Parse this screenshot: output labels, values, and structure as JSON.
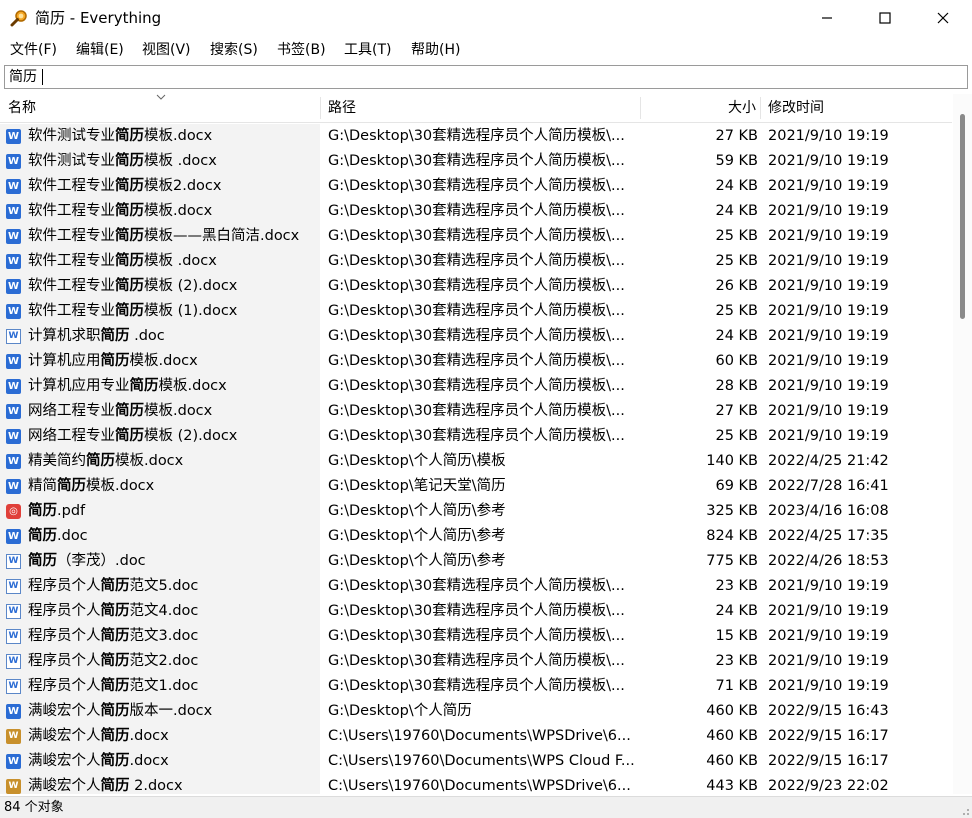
{
  "window": {
    "title": "简历 - Everything"
  },
  "menu": [
    "文件(F)",
    "编辑(E)",
    "视图(V)",
    "搜索(S)",
    "书签(B)",
    "工具(T)",
    "帮助(H)"
  ],
  "search": {
    "value": "简历"
  },
  "columns": {
    "name": "名称",
    "path": "路径",
    "size": "大小",
    "modified": "修改时间"
  },
  "icons": {
    "app": "magnifier-icon",
    "minimize": "minimize-icon",
    "maximize": "maximize-icon",
    "close": "close-icon"
  },
  "files": [
    {
      "pre": "软件测试专业",
      "hl": "简历",
      "post": "模板.docx",
      "type": "docx",
      "path": "G:\\Desktop\\30套精选程序员个人简历模板\\...",
      "size": "27 KB",
      "date": "2021/9/10 19:19"
    },
    {
      "pre": "软件测试专业",
      "hl": "简历",
      "post": "模板 .docx",
      "type": "docx",
      "path": "G:\\Desktop\\30套精选程序员个人简历模板\\...",
      "size": "59 KB",
      "date": "2021/9/10 19:19"
    },
    {
      "pre": "软件工程专业",
      "hl": "简历",
      "post": "模板2.docx",
      "type": "docx",
      "path": "G:\\Desktop\\30套精选程序员个人简历模板\\...",
      "size": "24 KB",
      "date": "2021/9/10 19:19"
    },
    {
      "pre": "软件工程专业",
      "hl": "简历",
      "post": "模板.docx",
      "type": "docx",
      "path": "G:\\Desktop\\30套精选程序员个人简历模板\\...",
      "size": "24 KB",
      "date": "2021/9/10 19:19"
    },
    {
      "pre": "软件工程专业",
      "hl": "简历",
      "post": "模板——黑白简洁.docx",
      "type": "docx",
      "path": "G:\\Desktop\\30套精选程序员个人简历模板\\...",
      "size": "25 KB",
      "date": "2021/9/10 19:19"
    },
    {
      "pre": "软件工程专业",
      "hl": "简历",
      "post": "模板 .docx",
      "type": "docx",
      "path": "G:\\Desktop\\30套精选程序员个人简历模板\\...",
      "size": "25 KB",
      "date": "2021/9/10 19:19"
    },
    {
      "pre": "软件工程专业",
      "hl": "简历",
      "post": "模板 (2).docx",
      "type": "docx",
      "path": "G:\\Desktop\\30套精选程序员个人简历模板\\...",
      "size": "26 KB",
      "date": "2021/9/10 19:19"
    },
    {
      "pre": "软件工程专业",
      "hl": "简历",
      "post": "模板 (1).docx",
      "type": "docx",
      "path": "G:\\Desktop\\30套精选程序员个人简历模板\\...",
      "size": "25 KB",
      "date": "2021/9/10 19:19"
    },
    {
      "pre": "计算机求职",
      "hl": "简历",
      "post": " .doc",
      "type": "doc",
      "path": "G:\\Desktop\\30套精选程序员个人简历模板\\...",
      "size": "24 KB",
      "date": "2021/9/10 19:19"
    },
    {
      "pre": "计算机应用",
      "hl": "简历",
      "post": "模板.docx",
      "type": "docx",
      "path": "G:\\Desktop\\30套精选程序员个人简历模板\\...",
      "size": "60 KB",
      "date": "2021/9/10 19:19"
    },
    {
      "pre": "计算机应用专业",
      "hl": "简历",
      "post": "模板.docx",
      "type": "docx",
      "path": "G:\\Desktop\\30套精选程序员个人简历模板\\...",
      "size": "28 KB",
      "date": "2021/9/10 19:19"
    },
    {
      "pre": "网络工程专业",
      "hl": "简历",
      "post": "模板.docx",
      "type": "docx",
      "path": "G:\\Desktop\\30套精选程序员个人简历模板\\...",
      "size": "27 KB",
      "date": "2021/9/10 19:19"
    },
    {
      "pre": "网络工程专业",
      "hl": "简历",
      "post": "模板 (2).docx",
      "type": "docx",
      "path": "G:\\Desktop\\30套精选程序员个人简历模板\\...",
      "size": "25 KB",
      "date": "2021/9/10 19:19"
    },
    {
      "pre": "精美简约",
      "hl": "简历",
      "post": "模板.docx",
      "type": "docx",
      "path": "G:\\Desktop\\个人简历\\模板",
      "size": "140 KB",
      "date": "2022/4/25 21:42"
    },
    {
      "pre": "精简",
      "hl": "简历",
      "post": "模板.docx",
      "type": "docx",
      "path": "G:\\Desktop\\笔记天堂\\简历",
      "size": "69 KB",
      "date": "2022/7/28 16:41"
    },
    {
      "pre": "",
      "hl": "简历",
      "post": ".pdf",
      "type": "pdf",
      "path": "G:\\Desktop\\个人简历\\参考",
      "size": "325 KB",
      "date": "2023/4/16 16:08"
    },
    {
      "pre": "",
      "hl": "简历",
      "post": ".doc",
      "type": "docx",
      "path": "G:\\Desktop\\个人简历\\参考",
      "size": "824 KB",
      "date": "2022/4/25 17:35"
    },
    {
      "pre": "",
      "hl": "简历",
      "post": "（李茂）.doc",
      "type": "doc",
      "path": "G:\\Desktop\\个人简历\\参考",
      "size": "775 KB",
      "date": "2022/4/26 18:53"
    },
    {
      "pre": "程序员个人",
      "hl": "简历",
      "post": "范文5.doc",
      "type": "doc",
      "path": "G:\\Desktop\\30套精选程序员个人简历模板\\...",
      "size": "23 KB",
      "date": "2021/9/10 19:19"
    },
    {
      "pre": "程序员个人",
      "hl": "简历",
      "post": "范文4.doc",
      "type": "doc",
      "path": "G:\\Desktop\\30套精选程序员个人简历模板\\...",
      "size": "24 KB",
      "date": "2021/9/10 19:19"
    },
    {
      "pre": "程序员个人",
      "hl": "简历",
      "post": "范文3.doc",
      "type": "doc",
      "path": "G:\\Desktop\\30套精选程序员个人简历模板\\...",
      "size": "15 KB",
      "date": "2021/9/10 19:19"
    },
    {
      "pre": "程序员个人",
      "hl": "简历",
      "post": "范文2.doc",
      "type": "doc",
      "path": "G:\\Desktop\\30套精选程序员个人简历模板\\...",
      "size": "23 KB",
      "date": "2021/9/10 19:19"
    },
    {
      "pre": "程序员个人",
      "hl": "简历",
      "post": "范文1.doc",
      "type": "doc",
      "path": "G:\\Desktop\\30套精选程序员个人简历模板\\...",
      "size": "71 KB",
      "date": "2021/9/10 19:19"
    },
    {
      "pre": "满峻宏个人",
      "hl": "简历",
      "post": "版本一.docx",
      "type": "docx",
      "path": "G:\\Desktop\\个人简历",
      "size": "460 KB",
      "date": "2022/9/15 16:43"
    },
    {
      "pre": "满峻宏个人",
      "hl": "简历",
      "post": ".docx",
      "type": "wps",
      "path": "C:\\Users\\19760\\Documents\\WPSDrive\\6...",
      "size": "460 KB",
      "date": "2022/9/15 16:17"
    },
    {
      "pre": "满峻宏个人",
      "hl": "简历",
      "post": ".docx",
      "type": "docx",
      "path": "C:\\Users\\19760\\Documents\\WPS Cloud F...",
      "size": "460 KB",
      "date": "2022/9/15 16:17"
    },
    {
      "pre": "满峻宏个人",
      "hl": "简历",
      "post": " 2.docx",
      "type": "wps",
      "path": "C:\\Users\\19760\\Documents\\WPSDrive\\6...",
      "size": "443 KB",
      "date": "2022/9/23 22:02"
    }
  ],
  "status": {
    "text": "84 个对象"
  }
}
